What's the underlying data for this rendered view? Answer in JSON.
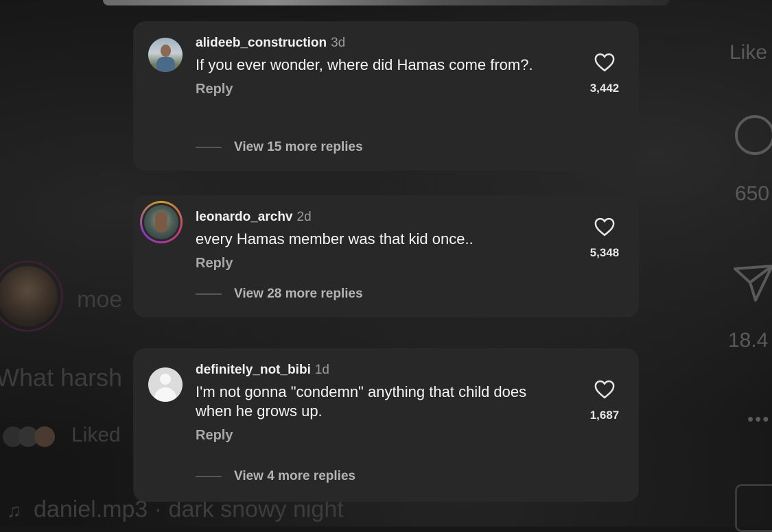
{
  "background": {
    "caption_username": "moe",
    "caption_text": "What harsh",
    "liked_text": "Liked",
    "music": "daniel.mp3 · dark snowy night",
    "rail": {
      "like_label": "Like",
      "comments_count": "650",
      "shares_count": "18.4"
    }
  },
  "comments": [
    {
      "username": "alideeb_construction",
      "time": "3d",
      "text": "If you ever wonder, where did Hamas come from?.",
      "reply_label": "Reply",
      "view_replies": "View 15 more replies",
      "likes": "3,442"
    },
    {
      "username": "leonardo_archv",
      "time": "2d",
      "text": "every Hamas member was that kid once..",
      "reply_label": "Reply",
      "view_replies": "View 28 more replies",
      "likes": "5,348"
    },
    {
      "username": "definitely_not_bibi",
      "time": "1d",
      "text": "I'm not gonna \"condemn\" anything that child does when he grows up.",
      "reply_label": "Reply",
      "view_replies": "View 4 more replies",
      "likes": "1,687"
    }
  ],
  "colors": {
    "card_bg": "#282828",
    "page_bg": "#151515",
    "story_ring": "#c23a7a"
  }
}
